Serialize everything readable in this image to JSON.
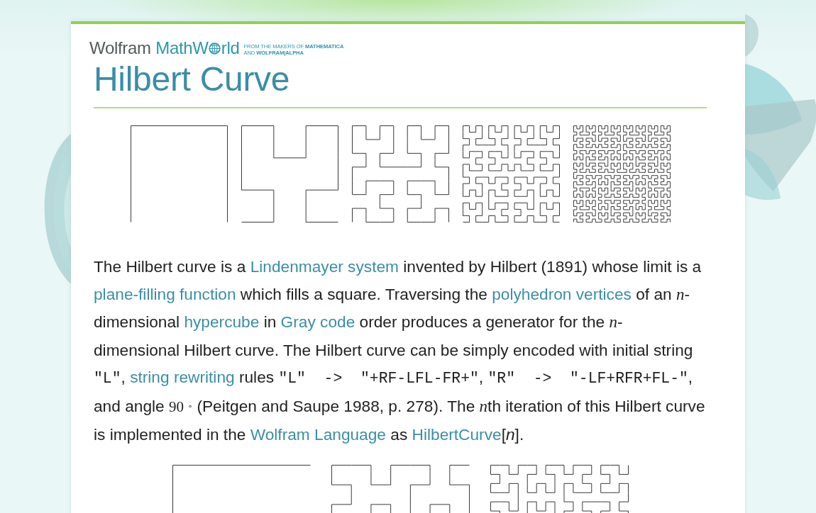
{
  "logo": {
    "brand": "Wolfram",
    "name_before_globe": "MathW",
    "name_after_globe": "rld",
    "tagline": [
      "FROM THE MAKERS OF **MATHEMATICA**",
      "AND **WOLFRAM|ALPHA**"
    ]
  },
  "title": "Hilbert Curve",
  "paragraph": [
    {
      "kind": "text",
      "text": "The Hilbert curve is a "
    },
    {
      "kind": "link",
      "text": "Lindenmayer system"
    },
    {
      "kind": "text",
      "text": " invented by Hilbert (1891) whose limit is a "
    },
    {
      "kind": "link",
      "text": "plane-filling function"
    },
    {
      "kind": "text",
      "text": " which fills a square. Traversing the "
    },
    {
      "kind": "link",
      "text": "polyhedron vertices"
    },
    {
      "kind": "text",
      "text": " of an "
    },
    {
      "kind": "math",
      "text": "n"
    },
    {
      "kind": "text",
      "text": "-dimensional "
    },
    {
      "kind": "link",
      "text": "hypercube"
    },
    {
      "kind": "text",
      "text": " in "
    },
    {
      "kind": "link",
      "text": "Gray code"
    },
    {
      "kind": "text",
      "text": " order produces a generator for the "
    },
    {
      "kind": "math",
      "text": "n"
    },
    {
      "kind": "text",
      "text": "-dimensional Hilbert curve. The Hilbert curve can be simply encoded with initial string "
    },
    {
      "kind": "code",
      "text": "\"L\""
    },
    {
      "kind": "text",
      "text": ", "
    },
    {
      "kind": "link",
      "text": "string rewriting"
    },
    {
      "kind": "text",
      "text": " rules "
    },
    {
      "kind": "code",
      "text": "\"L\"  ->  \"+RF-LFL-FR+\""
    },
    {
      "kind": "text",
      "text": ", "
    },
    {
      "kind": "code",
      "text": "\"R\"  ->  \"-LF+RFR+FL-\""
    },
    {
      "kind": "text",
      "text": ", and angle "
    },
    {
      "kind": "numeral",
      "text": "90 $^{∘}$"
    },
    {
      "kind": "text",
      "text": " (Peitgen and Saupe 1988, p. 278). The "
    },
    {
      "kind": "math",
      "text": "n"
    },
    {
      "kind": "text",
      "text": "th iteration of this Hilbert curve is implemented in the "
    },
    {
      "kind": "link",
      "text": "Wolfram Language"
    },
    {
      "kind": "text",
      "text": " as "
    },
    {
      "kind": "link",
      "text": "HilbertCurve"
    },
    {
      "kind": "text",
      "text": "[*n*]."
    }
  ]
}
